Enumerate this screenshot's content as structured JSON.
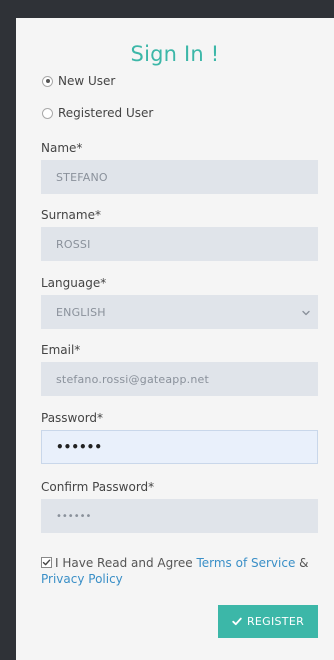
{
  "title": "Sign In !",
  "user_type": {
    "options": [
      {
        "label": "New User",
        "checked": true
      },
      {
        "label": "Registered User",
        "checked": false
      }
    ]
  },
  "fields": {
    "name": {
      "label": "Name*",
      "value": "STEFANO"
    },
    "surname": {
      "label": "Surname*",
      "value": "ROSSI"
    },
    "language": {
      "label": "Language*",
      "value": "ENGLISH"
    },
    "email": {
      "label": "Email*",
      "value": "stefano.rossi@gateapp.net"
    },
    "password": {
      "label": "Password*",
      "value": "••••••"
    },
    "confirm_password": {
      "label": "Confirm Password*",
      "value": "••••••"
    }
  },
  "agreement": {
    "checked": true,
    "prefix": "I Have Read and Agree ",
    "terms_link": "Terms of Service",
    "connector": " & ",
    "privacy_link": "Privacy Policy"
  },
  "register_button": {
    "label": "REGISTER",
    "icon": "check-icon"
  },
  "colors": {
    "accent": "#3cb7a8",
    "link": "#3a8fc7",
    "background": "#2f3237",
    "panel": "#f5f5f5",
    "field": "#e0e4ea"
  }
}
